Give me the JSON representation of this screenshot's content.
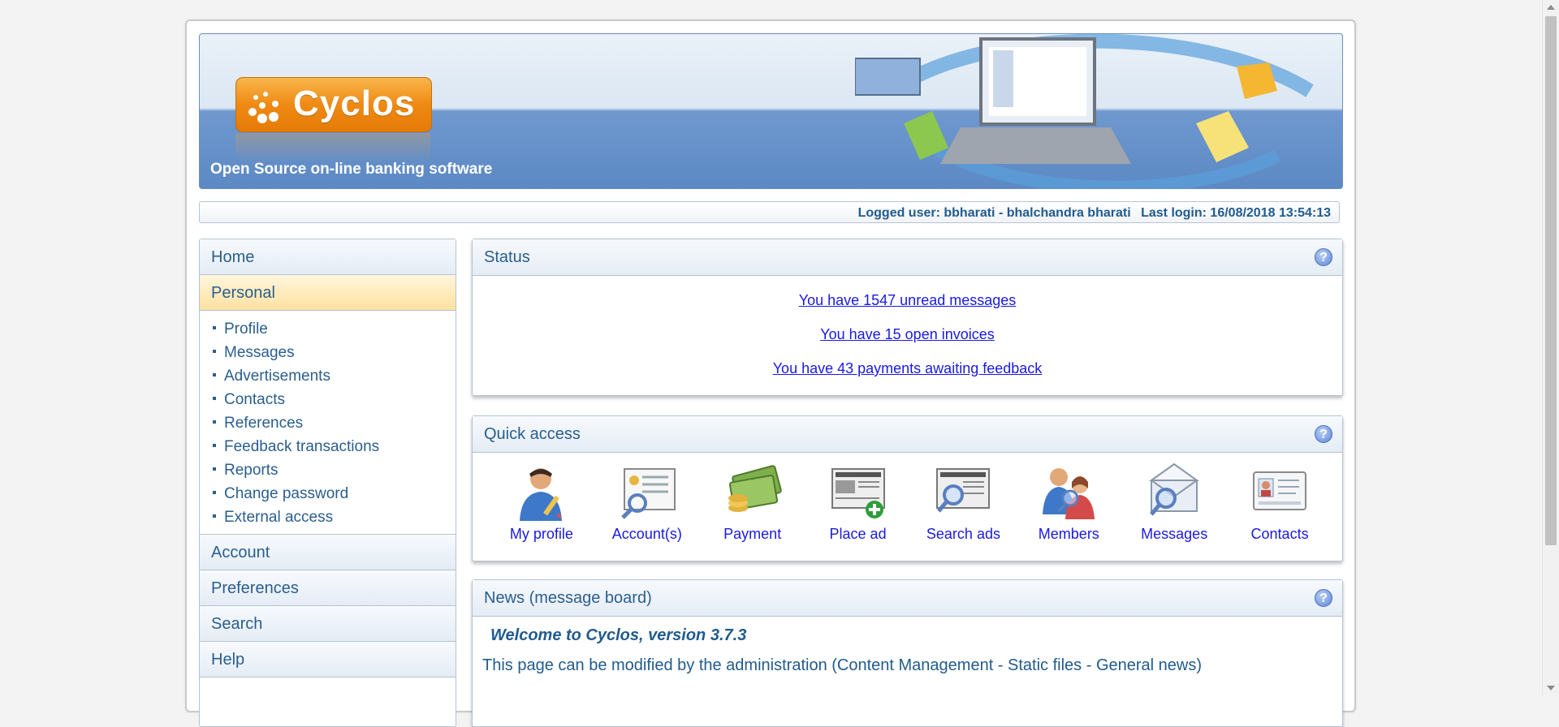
{
  "header": {
    "logo_text": "Cyclos",
    "tagline": "Open Source on-line banking software"
  },
  "login_bar": {
    "logged_user": "Logged user: bbharati - bhalchandra bharati",
    "last_login": "Last login: 16/08/2018 13:54:13"
  },
  "menu": {
    "home": "Home",
    "personal": "Personal",
    "personal_items": [
      "Profile",
      "Messages",
      "Advertisements",
      "Contacts",
      "References",
      "Feedback transactions",
      "Reports",
      "Change password",
      "External access"
    ],
    "account": "Account",
    "preferences": "Preferences",
    "search": "Search",
    "help": "Help"
  },
  "status_panel": {
    "title": "Status",
    "links": [
      "You have 1547 unread messages",
      "You have 15 open invoices",
      "You have 43 payments awaiting feedback"
    ]
  },
  "quick_access": {
    "title": "Quick access",
    "items": [
      {
        "label": "My profile",
        "icon": "my-profile-icon"
      },
      {
        "label": "Account(s)",
        "icon": "accounts-icon"
      },
      {
        "label": "Payment",
        "icon": "payment-icon"
      },
      {
        "label": "Place ad",
        "icon": "place-ad-icon"
      },
      {
        "label": "Search ads",
        "icon": "search-ads-icon"
      },
      {
        "label": "Members",
        "icon": "members-icon"
      },
      {
        "label": "Messages",
        "icon": "messages-icon"
      },
      {
        "label": "Contacts",
        "icon": "contacts-icon"
      }
    ]
  },
  "news_panel": {
    "title": "News (message board)",
    "heading": "Welcome to Cyclos, version 3.7.3",
    "body": "This page can be modified by the administration (Content Management - Static files - General news)"
  },
  "help_icon_glyph": "?",
  "colors": {
    "link": "#1a1ae0",
    "menu_text": "#2a5e8e",
    "logo_orange": "#ef8a14",
    "active_menu": "#fde1a0"
  }
}
